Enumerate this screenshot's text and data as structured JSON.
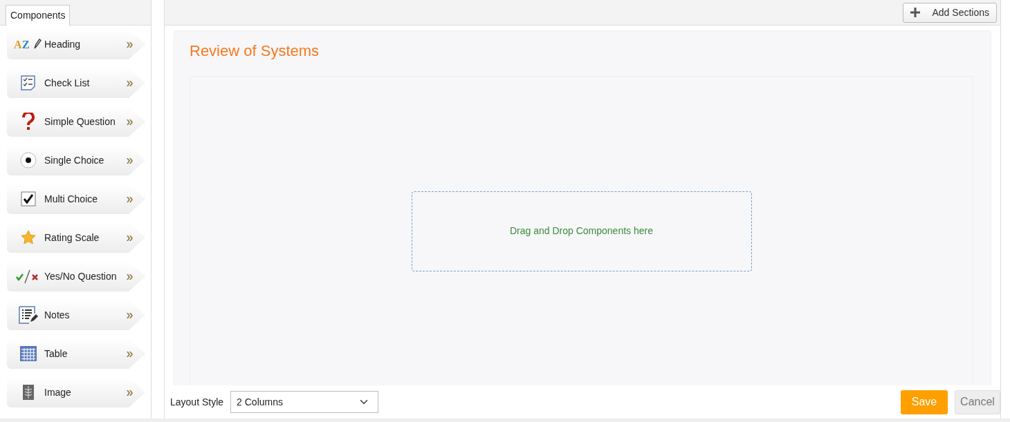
{
  "sidebar": {
    "tab": "Components",
    "items": [
      {
        "kind": "heading",
        "label": "Heading",
        "icon_letters": [
          "A",
          "Z"
        ]
      },
      {
        "kind": "checklist",
        "label": "Check List"
      },
      {
        "kind": "question",
        "label": "Simple Question"
      },
      {
        "kind": "single",
        "label": "Single Choice"
      },
      {
        "kind": "multi",
        "label": "Multi Choice"
      },
      {
        "kind": "rating",
        "label": "Rating Scale"
      },
      {
        "kind": "yesno",
        "label": "Yes/No Question"
      },
      {
        "kind": "notes",
        "label": "Notes"
      },
      {
        "kind": "table",
        "label": "Table"
      },
      {
        "kind": "image",
        "label": "Image"
      }
    ]
  },
  "toolbar": {
    "add_button": "Add Sections"
  },
  "section": {
    "title": "Review of Systems",
    "drop_hint": "Drag and Drop Components here"
  },
  "footer": {
    "layout_label": "Layout Style",
    "layout_value": "2 Columns",
    "save": "Save",
    "cancel": "Cancel"
  }
}
